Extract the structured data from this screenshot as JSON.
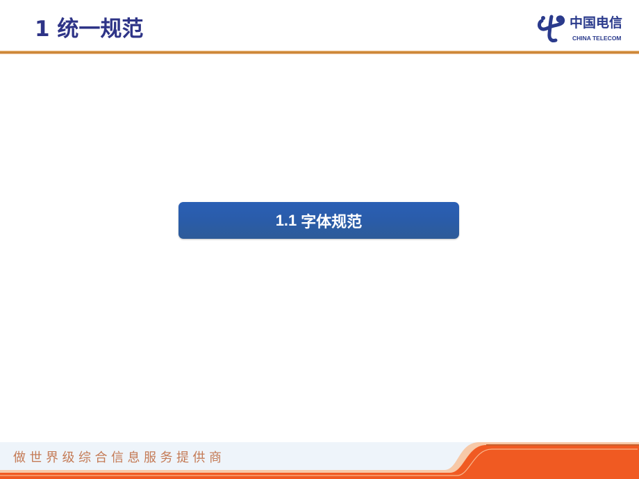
{
  "header": {
    "title": "1 统一规范",
    "logo": {
      "icon": "china-telecom-logo-icon",
      "name_cn": "中国电信",
      "name_en": "CHINA TELECOM"
    }
  },
  "main": {
    "section_button": {
      "number": "1.1",
      "label": "字体规范"
    }
  },
  "footer": {
    "slogan": "做世界级综合信息服务提供商"
  },
  "colors": {
    "title": "#2e3487",
    "accent_orange": "#f05a22",
    "button_blue": "#2a5ca9",
    "rule_gold": "#c47d2c"
  }
}
